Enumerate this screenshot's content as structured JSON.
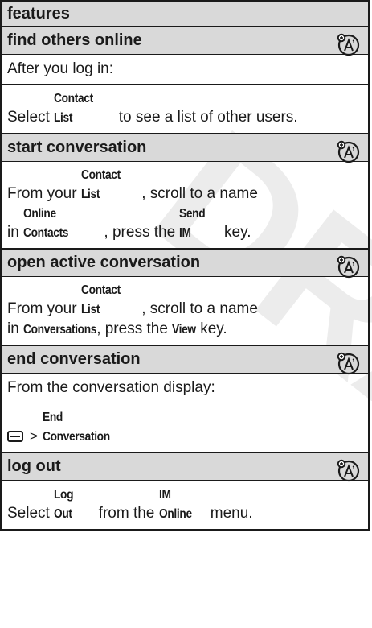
{
  "watermark": "DRAFT",
  "table": {
    "header": "features",
    "features": [
      {
        "title": "find others online",
        "icon": "network-dependent-feature-icon",
        "lines": [
          {
            "parts": [
              {
                "text": "After you log in:",
                "key": false
              }
            ]
          },
          {
            "parts": [
              {
                "text": "Select ",
                "key": false
              },
              {
                "text": "Contact List",
                "key": true
              },
              {
                "text": " to see a list of other users.",
                "key": false
              }
            ]
          }
        ]
      },
      {
        "title": "start conversation",
        "icon": "network-dependent-feature-icon",
        "lines": [
          {
            "double": true,
            "parts": [
              {
                "text": "From your ",
                "key": false
              },
              {
                "text": "Contact List",
                "key": true
              },
              {
                "text": ", scroll to a name",
                "key": false
              },
              {
                "break": true
              },
              {
                "text": "in ",
                "key": false
              },
              {
                "text": "Online Contacts",
                "key": true
              },
              {
                "text": ", press the ",
                "key": false
              },
              {
                "text": "Send IM",
                "key": true
              },
              {
                "text": " key.",
                "key": false
              }
            ]
          }
        ]
      },
      {
        "title": "open active conversation",
        "icon": "network-dependent-feature-icon",
        "lines": [
          {
            "double": true,
            "parts": [
              {
                "text": "From your ",
                "key": false
              },
              {
                "text": "Contact List",
                "key": true
              },
              {
                "text": ", scroll to a name",
                "key": false
              },
              {
                "break": true
              },
              {
                "text": "in ",
                "key": false
              },
              {
                "text": "Conversations",
                "key": true
              },
              {
                "text": ", press the ",
                "key": false
              },
              {
                "text": "View",
                "key": true
              },
              {
                "text": " key.",
                "key": false
              }
            ]
          }
        ]
      },
      {
        "title": "end conversation",
        "icon": "network-dependent-feature-icon",
        "lines": [
          {
            "parts": [
              {
                "text": "From the conversation display:",
                "key": false
              }
            ]
          },
          {
            "menu": true,
            "parts": [
              {
                "text": ">",
                "gt": true
              },
              {
                "text": "End Conversation",
                "key": true
              }
            ]
          }
        ]
      },
      {
        "title": "log out",
        "icon": "network-dependent-feature-icon",
        "lines": [
          {
            "parts": [
              {
                "text": "Select ",
                "key": false
              },
              {
                "text": "Log Out",
                "key": true
              },
              {
                "text": " from the ",
                "key": false
              },
              {
                "text": "IM Online",
                "key": true
              },
              {
                "text": " menu.",
                "key": false
              }
            ]
          }
        ]
      }
    ]
  }
}
